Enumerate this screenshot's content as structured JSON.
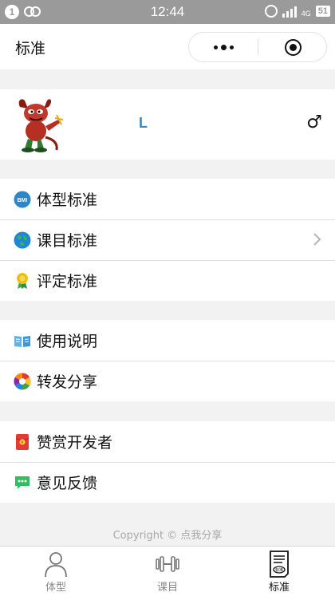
{
  "status_bar": {
    "time": "12:44",
    "notification_badge": "1",
    "network": "4G",
    "battery": "51"
  },
  "navbar": {
    "title": "标准"
  },
  "profile": {
    "username": "L",
    "gender_symbol": "♂"
  },
  "menu_groups": [
    {
      "items": [
        {
          "label": "体型标准",
          "icon": "bmi-icon"
        },
        {
          "label": "课目标准",
          "icon": "globe-icon",
          "has_chevron": true
        },
        {
          "label": "评定标准",
          "icon": "medal-icon"
        }
      ]
    },
    {
      "items": [
        {
          "label": "使用说明",
          "icon": "book-icon"
        },
        {
          "label": "转发分享",
          "icon": "share-icon"
        }
      ]
    },
    {
      "items": [
        {
          "label": "赞赏开发者",
          "icon": "red-envelope-icon"
        },
        {
          "label": "意见反馈",
          "icon": "chat-icon"
        }
      ]
    }
  ],
  "bmi_icon_text": "BMI",
  "copyright": "Copyright © 点我分享",
  "tabbar": {
    "tabs": [
      {
        "label": "体型",
        "icon": "person-icon"
      },
      {
        "label": "课目",
        "icon": "dumbbell-icon"
      },
      {
        "label": "标准",
        "icon": "standard-doc-icon",
        "active": true
      }
    ],
    "doc_icon_text": "标准"
  },
  "colors": {
    "status_bar": "#9a9a9a",
    "username": "#3a86c8",
    "background": "#f2f2f2"
  }
}
